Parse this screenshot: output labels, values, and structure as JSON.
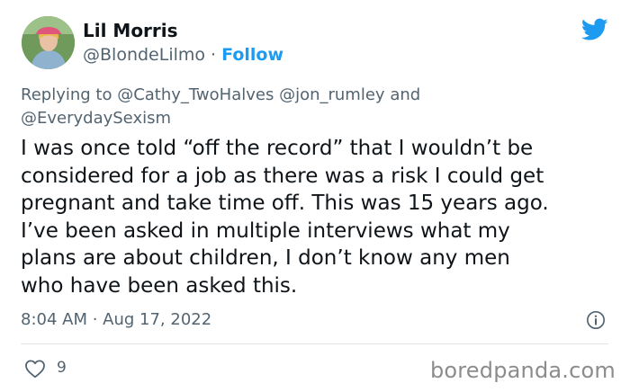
{
  "author": {
    "display_name": "Lil Morris",
    "handle": "@BlondeLilmo",
    "separator": " · ",
    "follow_label": "Follow"
  },
  "reply": {
    "prefix": "Replying to ",
    "mentions": [
      "@Cathy_TwoHalves",
      "@jon_rumley",
      "@EverydaySexism"
    ],
    "and_word": "and"
  },
  "tweet": {
    "lines": [
      "I was once told “off the record” that I wouldn’t be",
      "considered for a job as there was a risk I could get",
      "pregnant and take time off. This was 15 years ago.",
      "I’ve been asked in multiple interviews what my",
      "plans are about children, I don’t know any men",
      "who have been asked this."
    ]
  },
  "meta": {
    "timestamp": "8:04 AM · Aug 17, 2022"
  },
  "engagement": {
    "likes": "9"
  },
  "watermark": "boredpanda.com",
  "icons": {
    "brand": "twitter-bird-icon",
    "info": "info-icon",
    "like": "heart-icon"
  },
  "colors": {
    "accent": "#1d9bf0",
    "text": "#0f1419",
    "secondary": "#536471"
  }
}
